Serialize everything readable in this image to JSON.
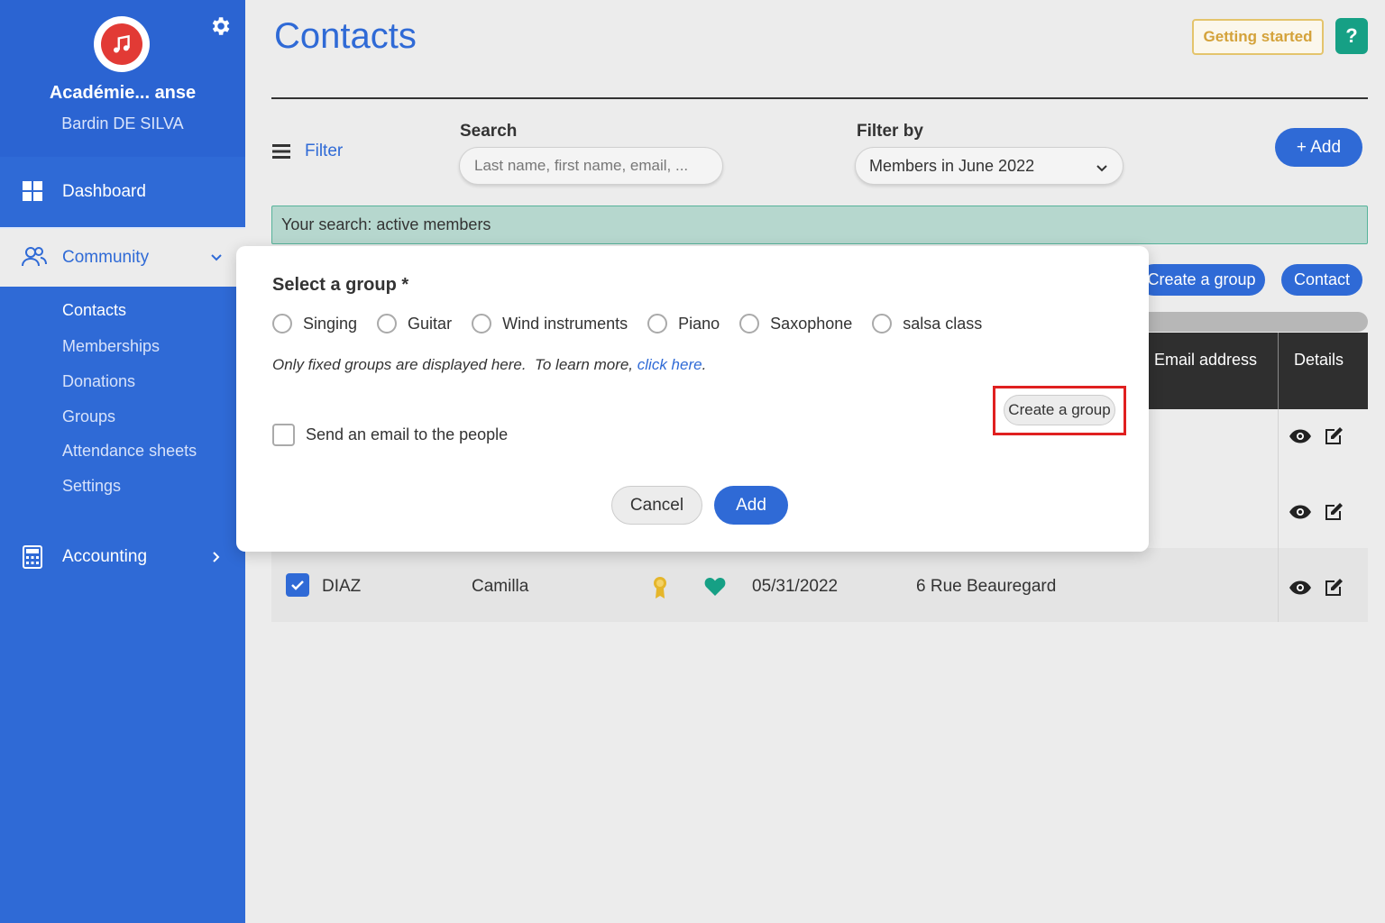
{
  "sidebar": {
    "org_name": "Académie... anse",
    "user_name": "Bardin DE SILVA",
    "nav": {
      "dashboard": "Dashboard",
      "community": "Community",
      "accounting": "Accounting"
    },
    "community_items": [
      "Contacts",
      "Memberships",
      "Donations",
      "Groups",
      "Attendance sheets",
      "Settings"
    ],
    "active_item": "Contacts"
  },
  "header": {
    "title": "Contacts",
    "getting_started": "Getting started",
    "help": "?"
  },
  "filters": {
    "filter_label": "Filter",
    "search_label": "Search",
    "search_placeholder": "Last name, first name, email, ...",
    "filterby_label": "Filter by",
    "filterby_value": "Members in June 2022",
    "add_label": "+ Add"
  },
  "search_banner": "Your search: active members",
  "actions": {
    "create_group": "Create a group",
    "contact": "Contact"
  },
  "table": {
    "headers": {
      "email": "Email address",
      "details": "Details"
    },
    "visible_row": {
      "last_name": "DIAZ",
      "first_name": "Camilla",
      "date": "05/31/2022",
      "address": "6 Rue Beauregard"
    }
  },
  "modal": {
    "title": "Select a group *",
    "groups": [
      "Singing",
      "Guitar",
      "Wind instruments",
      "Piano",
      "Saxophone",
      "salsa class"
    ],
    "note_prefix": "Only fixed groups are displayed here.  To learn more, ",
    "note_link": "click here",
    "note_suffix": ".",
    "email_checkbox": "Send an email to the people",
    "create_group": "Create a group",
    "cancel": "Cancel",
    "add": "Add"
  },
  "colors": {
    "brand_blue": "#2f6ad6",
    "banner_green": "#b6d7ce",
    "help_green": "#16a085",
    "highlight_red": "#e02020",
    "heart_teal": "#16a085",
    "medal_gold": "#e5b62b"
  },
  "icons": {
    "logo": "music-note-icon",
    "settings": "gear-icon",
    "dashboard": "grid-icon",
    "community": "users-icon",
    "accounting": "calculator-icon",
    "details_view": "eye-icon",
    "details_edit": "edit-icon"
  }
}
